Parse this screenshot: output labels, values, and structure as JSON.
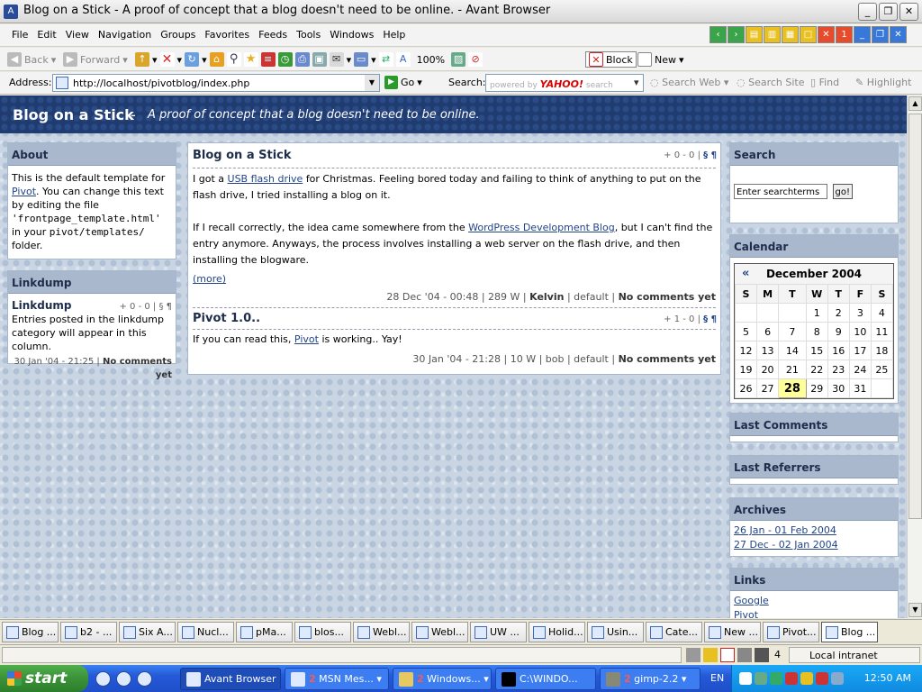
{
  "window": {
    "title": "Blog on a Stick - A proof of concept that a blog doesn't need to be online. - Avant Browser",
    "controls": [
      "_",
      "❐",
      "✕"
    ]
  },
  "menu": [
    "File",
    "Edit",
    "View",
    "Navigation",
    "Groups",
    "Favorites",
    "Feeds",
    "Tools",
    "Windows",
    "Help"
  ],
  "toolbar": {
    "back": "Back",
    "forward": "Forward",
    "zoom": "100%",
    "block": "Block",
    "new": "New"
  },
  "addressbar": {
    "address_label": "Address:",
    "url": "http://localhost/pivotblog/index.php",
    "go": "Go",
    "search_label": "Search:",
    "search_placeholder_prefix": "powered by",
    "search_brand": "YAHOO!",
    "search_placeholder_suffix": "search",
    "search_web": "Search Web",
    "search_site": "Search Site",
    "find": "Find",
    "highlight": "Highlight"
  },
  "blog": {
    "title": "Blog on a Stick",
    "separator": "-",
    "tagline": "A proof of concept that a blog doesn't need to be online."
  },
  "about": {
    "heading": "About",
    "text1": "This is the default template for",
    "pivot_link": "Pivot",
    "text2": ". You can change this text by editing the file",
    "filename": "'frontpage_template.html'",
    "text3": "in your",
    "folder": "pivot/templates/",
    "text4": "folder."
  },
  "linkdump": {
    "heading": "Linkdump",
    "entry_title": "Linkdump",
    "entry_counts": "+ 0 - 0 | § ¶",
    "entry_text": "Entries posted in the linkdump category will appear in this column.",
    "entry_date": "30 Jan '04 - 21:25 |",
    "entry_comments": "No comments yet"
  },
  "posts": [
    {
      "title": "Blog on a Stick",
      "counts": "+ 0 - 0 |",
      "marks": "§ ¶",
      "p1_a": "I got a",
      "p1_link": "USB flash drive",
      "p1_b": "for Christmas. Feeling bored today and failing to think of anything to put on the flash drive, I tried installing a blog on it.",
      "p2_a": "If I recall correctly, the idea came somewhere from the",
      "p2_link": "WordPress Development Blog",
      "p2_b": ", but I can't find the entry anymore. Anyways, the process involves installing a web server on the flash drive, and then installing the blogware.",
      "more": "(more)",
      "date": "28 Dec '04 - 00:48 | 289 W |",
      "author": "Kelvin",
      "category": "| default |",
      "comments": "No comments yet"
    },
    {
      "title": "Pivot 1.0..",
      "counts": "+ 1 - 0 |",
      "marks": "§ ¶",
      "p1_a": "If you can read this,",
      "p1_link": "Pivot",
      "p1_b": "is working.. Yay!",
      "date": "30 Jan '04 - 21:28 | 10 W | bob | default |",
      "comments": "No comments yet"
    }
  ],
  "search": {
    "heading": "Search",
    "placeholder": "Enter searchterms",
    "button": "go!"
  },
  "calendar": {
    "heading": "Calendar",
    "prev": "«",
    "month": "December 2004",
    "days": [
      "S",
      "M",
      "T",
      "W",
      "T",
      "F",
      "S"
    ],
    "weeks": [
      [
        "",
        "",
        "",
        "1",
        "2",
        "3",
        "4"
      ],
      [
        "5",
        "6",
        "7",
        "8",
        "9",
        "10",
        "11"
      ],
      [
        "12",
        "13",
        "14",
        "15",
        "16",
        "17",
        "18"
      ],
      [
        "19",
        "20",
        "21",
        "22",
        "23",
        "24",
        "25"
      ],
      [
        "26",
        "27",
        "28",
        "29",
        "30",
        "31",
        ""
      ]
    ],
    "today": "28"
  },
  "last_comments": {
    "heading": "Last Comments"
  },
  "last_referrers": {
    "heading": "Last Referrers"
  },
  "archives": {
    "heading": "Archives",
    "items": [
      "26 Jan - 01 Feb 2004",
      "27 Dec - 02 Jan 2004"
    ]
  },
  "links": {
    "heading": "Links",
    "items": [
      "Google",
      "Pivot"
    ]
  },
  "tabs": [
    "Blog ...",
    "b2 - ...",
    "Six A...",
    "Nucl...",
    "pMa...",
    "blos...",
    "Webl...",
    "Webl...",
    "UW ...",
    "Holid...",
    "Usin...",
    "Cate...",
    "New ...",
    "Pivot...",
    "Blog ..."
  ],
  "status": {
    "count": "4",
    "zone": "Local intranet"
  },
  "taskbar": {
    "start": "start",
    "tasks": [
      {
        "label": "Avant Browser",
        "count": ""
      },
      {
        "label": "MSN Mes...",
        "count": "2"
      },
      {
        "label": "Windows...",
        "count": "2"
      },
      {
        "label": "C:\\WINDO...",
        "count": ""
      },
      {
        "label": "gimp-2.2",
        "count": "2"
      }
    ],
    "lang": "EN",
    "clock": "12:50 AM"
  },
  "colors": {
    "header_bg": "#1f3b70",
    "box_header": "#a9b8cc",
    "link": "#224488",
    "today": "#ffff99",
    "xp_blue": "#2459d8",
    "xp_green": "#3a9238"
  }
}
